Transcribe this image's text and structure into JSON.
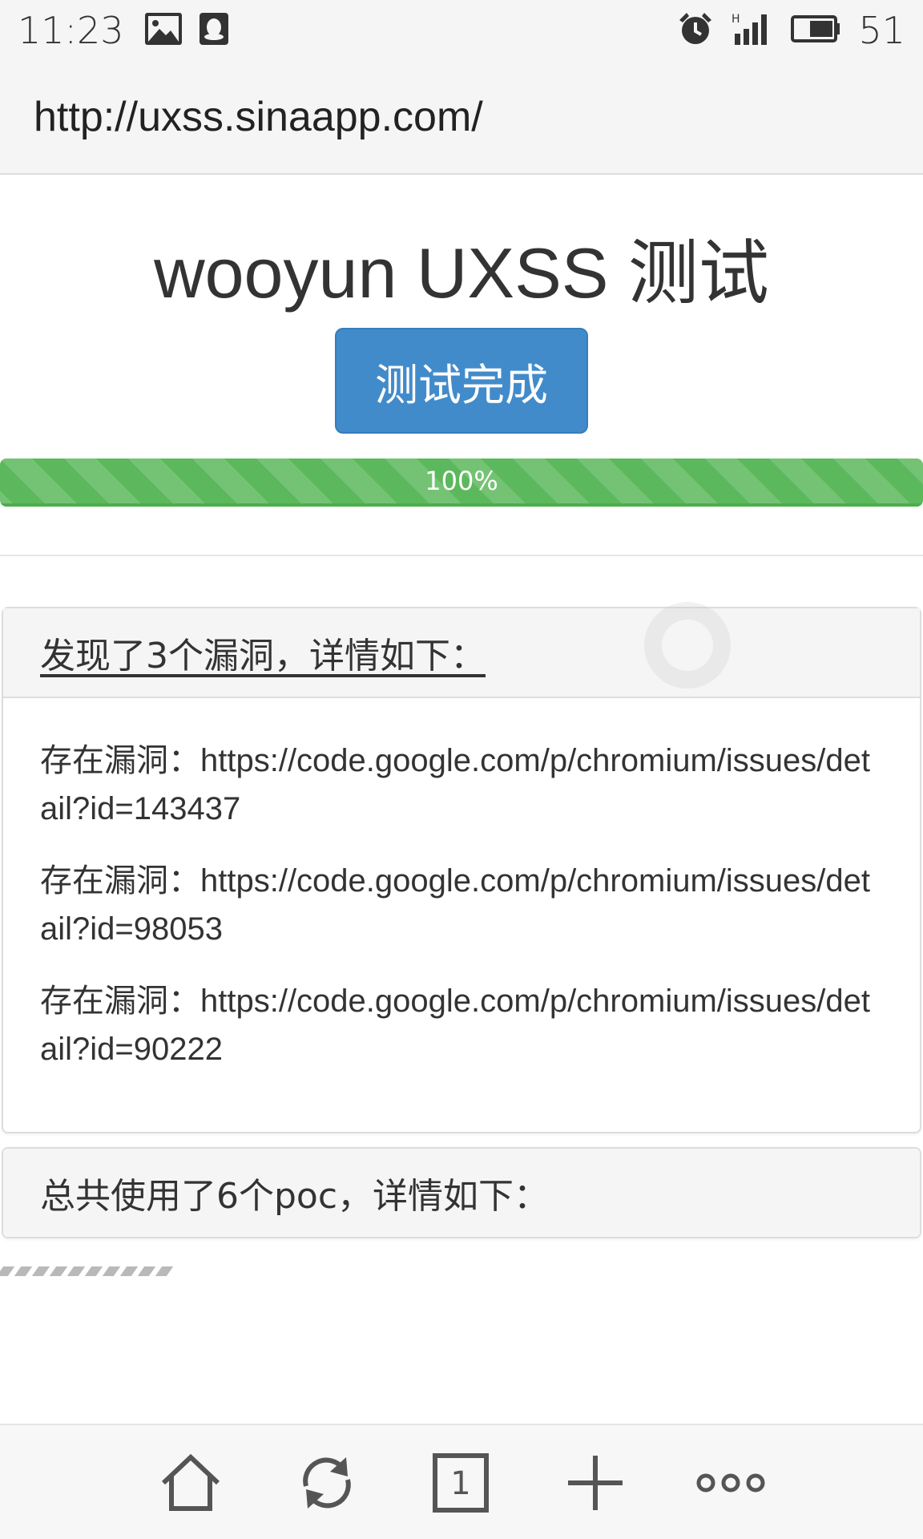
{
  "status_bar": {
    "time": "11:23",
    "battery_percent": "51",
    "icons": [
      "image-icon",
      "qq-icon",
      "alarm-icon",
      "signal-icon",
      "battery-icon"
    ]
  },
  "address_bar": {
    "url": "http://uxss.sinaapp.com/"
  },
  "page": {
    "title": "wooyun UXSS 测试",
    "status_button_label": "测试完成",
    "progress": {
      "percent": 100,
      "label": "100%"
    }
  },
  "vulnerabilities_panel": {
    "heading": "发现了3个漏洞，详情如下：",
    "items": [
      {
        "prefix": "存在漏洞：",
        "url": "https://code.google.com/p/chromium/issues/detail?id=143437"
      },
      {
        "prefix": "存在漏洞：",
        "url": "https://code.google.com/p/chromium/issues/detail?id=98053"
      },
      {
        "prefix": "存在漏洞：",
        "url": "https://code.google.com/p/chromium/issues/detail?id=90222"
      }
    ]
  },
  "poc_panel": {
    "heading": "总共使用了6个poc，详情如下："
  },
  "toolbar": {
    "tab_count": "1",
    "icons": [
      "home-icon",
      "refresh-icon",
      "tabs-icon",
      "new-tab-icon",
      "more-icon"
    ]
  },
  "colors": {
    "primary_button": "#428bca",
    "progress_success": "#5cb85c",
    "panel_heading_bg": "#f5f5f5",
    "panel_border": "#dddddd"
  }
}
